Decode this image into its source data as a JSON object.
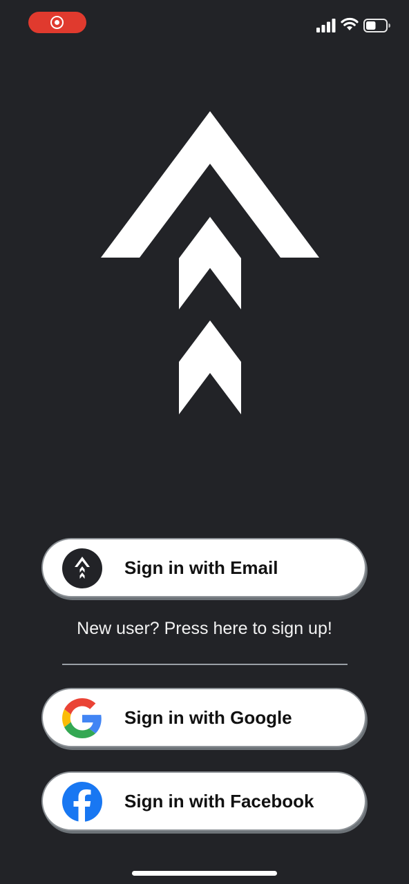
{
  "status_bar": {
    "record_indicator_icon": "screen-recording-icon",
    "signal_icon": "cellular-signal-icon",
    "wifi_icon": "wifi-icon",
    "battery_icon": "battery-icon",
    "battery_level": 0.5
  },
  "logo": {
    "icon": "triple-chevron-up-logo"
  },
  "buttons": {
    "email": {
      "label": "Sign in with Email",
      "icon": "app-logo-icon"
    },
    "google": {
      "label": "Sign in with Google",
      "icon": "google-icon"
    },
    "facebook": {
      "label": "Sign in with Facebook",
      "icon": "facebook-icon"
    }
  },
  "signup": {
    "text": "New user? Press here to sign up!"
  },
  "colors": {
    "background": "#222327",
    "button_bg": "#ffffff",
    "record_red": "#e03a2e",
    "facebook_blue": "#1877f2"
  }
}
